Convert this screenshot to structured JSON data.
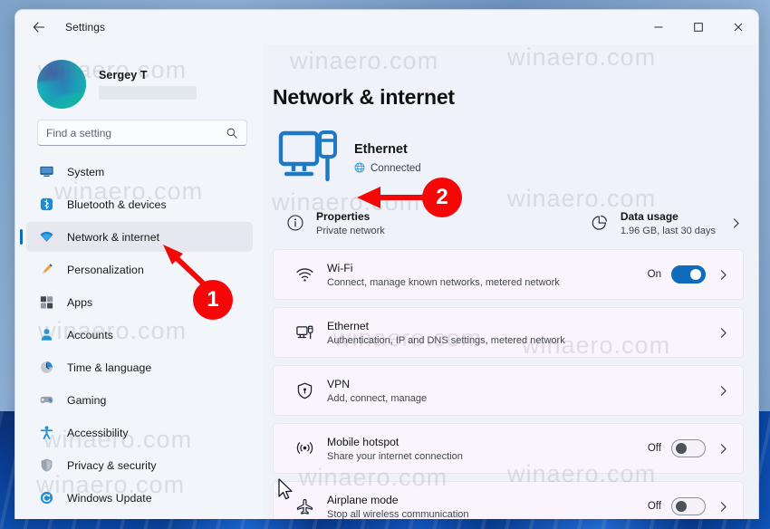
{
  "window": {
    "titlebar_title": "Settings",
    "back_icon": "arrow-left-icon",
    "controls": {
      "minimize": "minimize-icon",
      "maximize": "maximize-icon",
      "close": "close-icon"
    }
  },
  "sidebar": {
    "account": {
      "name": "Sergey T",
      "email_redacted": true,
      "avatar": "user-avatar"
    },
    "search": {
      "placeholder": "Find a setting",
      "value": "",
      "icon": "search-icon"
    },
    "items": [
      {
        "label": "System",
        "icon": "monitor-icon",
        "selected": false
      },
      {
        "label": "Bluetooth & devices",
        "icon": "bluetooth-icon",
        "selected": false
      },
      {
        "label": "Network & internet",
        "icon": "wifi-icon",
        "selected": true
      },
      {
        "label": "Personalization",
        "icon": "paintbrush-icon",
        "selected": false
      },
      {
        "label": "Apps",
        "icon": "apps-icon",
        "selected": false
      },
      {
        "label": "Accounts",
        "icon": "person-icon",
        "selected": false
      },
      {
        "label": "Time & language",
        "icon": "clock-icon",
        "selected": false
      },
      {
        "label": "Gaming",
        "icon": "gamepad-icon",
        "selected": false
      },
      {
        "label": "Accessibility",
        "icon": "accessibility-icon",
        "selected": false
      },
      {
        "label": "Privacy & security",
        "icon": "shield-icon",
        "selected": false
      },
      {
        "label": "Windows Update",
        "icon": "update-icon",
        "selected": false
      }
    ]
  },
  "main": {
    "page_title": "Network & internet",
    "status": {
      "icon": "ethernet-large-icon",
      "name": "Ethernet",
      "state": "Connected",
      "state_icon": "globe-icon"
    },
    "quick_actions": [
      {
        "title": "Properties",
        "subtitle": "Private network",
        "icon": "info-icon",
        "has_chevron": false
      },
      {
        "title": "Data usage",
        "subtitle": "1.96 GB, last 30 days",
        "icon": "pie-chart-icon",
        "has_chevron": true
      }
    ],
    "cards": [
      {
        "title": "Wi-Fi",
        "subtitle": "Connect, manage known networks, metered network",
        "icon": "wifi-icon",
        "toggle": {
          "present": true,
          "label": "On",
          "state": "on"
        },
        "chevron": true
      },
      {
        "title": "Ethernet",
        "subtitle": "Authentication, IP and DNS settings, metered network",
        "icon": "ethernet-icon",
        "toggle": {
          "present": false,
          "label": "",
          "state": ""
        },
        "chevron": true
      },
      {
        "title": "VPN",
        "subtitle": "Add, connect, manage",
        "icon": "vpn-shield-icon",
        "toggle": {
          "present": false,
          "label": "",
          "state": ""
        },
        "chevron": true
      },
      {
        "title": "Mobile hotspot",
        "subtitle": "Share your internet connection",
        "icon": "hotspot-icon",
        "toggle": {
          "present": true,
          "label": "Off",
          "state": "off"
        },
        "chevron": true
      },
      {
        "title": "Airplane mode",
        "subtitle": "Stop all wireless communication",
        "icon": "airplane-icon",
        "toggle": {
          "present": true,
          "label": "Off",
          "state": "off"
        },
        "chevron": true
      }
    ]
  },
  "annotations": {
    "accent_color": "#f50707",
    "badges": [
      {
        "number": "1"
      },
      {
        "number": "2"
      }
    ]
  },
  "watermarks": [
    {
      "text": "winaero.com"
    },
    {
      "text": "winaero.com"
    },
    {
      "text": "winaero.com"
    },
    {
      "text": "winaero.com"
    },
    {
      "text": "winaero.com"
    },
    {
      "text": "winaero.com"
    },
    {
      "text": "winaero.com"
    },
    {
      "text": "winaero.com"
    },
    {
      "text": "winaero.com"
    }
  ]
}
